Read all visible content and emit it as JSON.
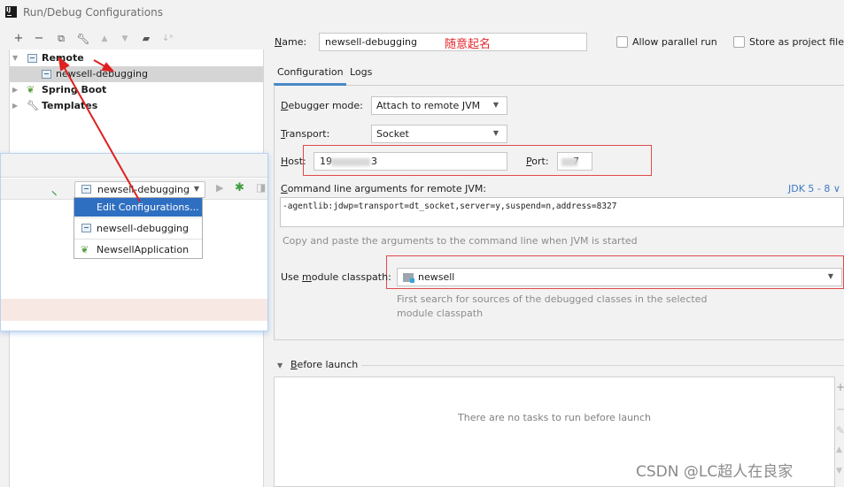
{
  "window": {
    "title": "Run/Debug Configurations",
    "logo": "IJ"
  },
  "toolbar": {
    "icons": [
      "add-icon",
      "remove-icon",
      "copy-icon",
      "wrench-icon",
      "move-up-icon",
      "move-down-icon",
      "new-folder-icon",
      "sort-icon"
    ]
  },
  "tree": {
    "items": [
      {
        "label": "Remote",
        "expanded": true,
        "bold": true,
        "icon": "remote-icon"
      },
      {
        "label": "newsell-debugging",
        "selected": true,
        "icon": "remote-config-icon"
      },
      {
        "label": "Spring Boot",
        "expanded": false,
        "bold": true,
        "icon": "spring-boot-icon"
      },
      {
        "label": "Templates",
        "expanded": false,
        "bold": true,
        "icon": "wrench-icon"
      }
    ]
  },
  "overlay": {
    "run_config_selector": "newsell-debugging",
    "dropdown_items": [
      {
        "label": "Edit Configurations...",
        "active": true
      },
      {
        "label": "newsell-debugging",
        "icon": "remote-config-icon"
      },
      {
        "label": "NewsellApplication",
        "icon": "spring-boot-icon"
      }
    ]
  },
  "form": {
    "name_label": "Name:",
    "name_value": "newsell-debugging",
    "name_annotation": "随意起名",
    "allow_parallel_run": {
      "label": "Allow parallel run",
      "checked": false
    },
    "store_as_project_file": {
      "label": "Store as project file",
      "checked": false
    },
    "tabs": [
      {
        "label": "Configuration",
        "active": true
      },
      {
        "label": "Logs",
        "active": false
      }
    ],
    "debugger_mode_label": "Debugger mode:",
    "debugger_mode_value": "Attach to remote JVM",
    "transport_label": "Transport:",
    "transport_value": "Socket",
    "host_label": "Host:",
    "host_value": "19        3",
    "port_label": "Port:",
    "port_value": "  7",
    "cmd_label": "Command line arguments for remote JVM:",
    "jdk_link": "JDK 5 - 8 ∨",
    "cmd_value": "-agentlib:jdwp=transport=dt_socket,server=y,suspend=n,address=8327",
    "cmd_hint": "Copy and paste the arguments to the command line when JVM is started",
    "module_label": "Use module classpath:",
    "module_value": "newsell",
    "module_hint_1": "First search for sources of the debugged classes in the selected",
    "module_hint_2": "module classpath"
  },
  "before_launch": {
    "label": "Before launch",
    "empty_text": "There are no tasks to run before launch",
    "side_tools": [
      "+",
      "−",
      "✎",
      "▲",
      "▼"
    ]
  },
  "watermark": "CSDN @LC超人在良家",
  "colors": {
    "accent": "#2f6fc1",
    "annotation": "#e3262b",
    "link": "#3d7ac4"
  }
}
